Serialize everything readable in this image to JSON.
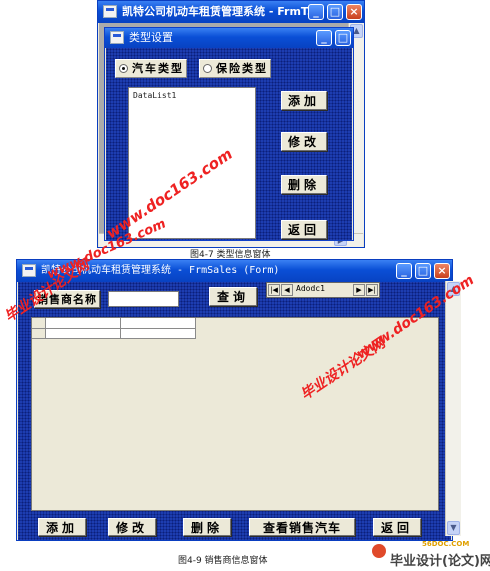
{
  "top_window": {
    "title": "凯特公司机动车租赁管理系统 - FrmT...",
    "dialog_title": "类型设置",
    "radio_vehicle": "汽车类型",
    "radio_insurance": "保险类型",
    "list_label": "DataList1",
    "btn_add": "添加",
    "btn_edit": "修改",
    "btn_delete": "删除",
    "btn_back": "返回"
  },
  "caption_top": "图4-7 类型信息窗体",
  "bottom_window": {
    "title": "凯特公司机动车租赁管理系统 - FrmSales (Form)",
    "label_name": "销售商名称",
    "btn_query": "查询",
    "nav_label": "Adodc1",
    "btn_add": "添加",
    "btn_edit": "修改",
    "btn_delete": "删除",
    "btn_view": "查看销售汽车",
    "btn_back": "返回"
  },
  "caption_bottom": "图4-9 销售商信息窗体",
  "watermarks": {
    "url": "www.doc163.com",
    "cn": "毕业设计论文网",
    "logo_top": "56DOC.COM",
    "logo_bottom": "毕业设计(论文)网"
  },
  "colors": {
    "xp_blue": "#0a4fd6",
    "form_blue": "#1d3db0",
    "button_face": "#ece9d8",
    "watermark_red": "#ee2222"
  }
}
